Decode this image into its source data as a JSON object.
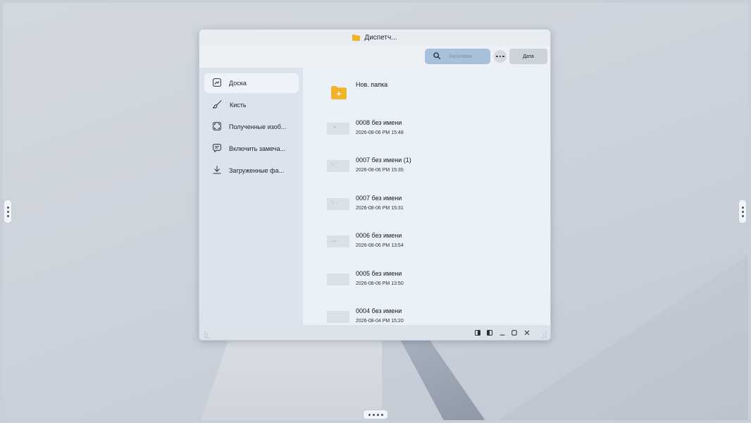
{
  "window": {
    "title": "Диспетч...",
    "folder_icon": "folder-icon",
    "accent": "#f0b429"
  },
  "toolbar": {
    "search_placeholder": "Заголовок",
    "more_icon": "more-icon",
    "sort_label": "Дата"
  },
  "sidebar": {
    "items": [
      {
        "label": "Доска",
        "icon": "board-icon",
        "active": true
      },
      {
        "label": "Кисть",
        "icon": "brush-icon"
      },
      {
        "label": "Полученные изоб...",
        "icon": "capture-icon"
      },
      {
        "label": "Включить замеча...",
        "icon": "note-icon"
      },
      {
        "label": "Загруженные фа...",
        "icon": "download-icon"
      }
    ]
  },
  "files": [
    {
      "name": "Нов. папка",
      "time": "",
      "type": "folder"
    },
    {
      "name": "0008 без имени",
      "time": "2026-08-06 PM 15:48"
    },
    {
      "name": "0007 без имени (1)",
      "time": "2026-08-06 PM 15:35"
    },
    {
      "name": "0007 без имени",
      "time": "2026-08-06 PM 15:31"
    },
    {
      "name": "0006 без имени",
      "time": "2026-08-06 PM 13:54"
    },
    {
      "name": "0005 без имени",
      "time": "2026-08-06 PM 13:50"
    },
    {
      "name": "0004 без имени",
      "time": "2026-08-04 PM 15:20"
    }
  ]
}
